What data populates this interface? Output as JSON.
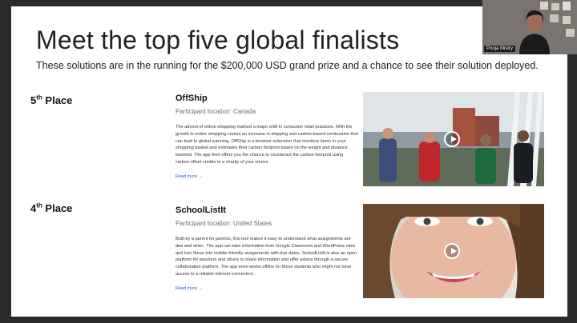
{
  "slide": {
    "title": "Meet the top five global finalists",
    "subtitle": "These solutions are in the running for the $200,000 USD grand prize and a chance to see their solution deployed."
  },
  "entries": [
    {
      "place_number": "5",
      "place_suffix": "th",
      "place_word": " Place",
      "name": "OffShip",
      "location": "Participant location: Canada",
      "description": "The advent of online shopping marked a major shift in consumer retail practices. With the growth in online shopping comes an increase in shipping and carbon-based combustion that can lead to global warming. OffShip is a browser extension that monitors items in your shopping basket and estimates their carbon footprint based on the weight and distance traveled. The app then offers you the chance to counteract the carbon footprint using carbon offset credits to a charity of your choice",
      "read_more": "Read more →"
    },
    {
      "place_number": "4",
      "place_suffix": "th",
      "place_word": " Place",
      "name": "SchoolListIt",
      "location": "Participant location: United States",
      "description": "Built by a parent for parents, this tool makes it easy to understand what assignments are due and when. The app can take information from Google Classroom and WordPress sites and turn these into mobile-friendly assignments with due dates. SchoolListIt is also an open platform for teachers and others to share information and offer advice through a secure collaboration platform. The app even works offline for those students who might not have access to a reliable internet connection.",
      "read_more": "Read more →"
    }
  ],
  "video_call": {
    "participant_name": "Pooja Mistry"
  },
  "icons": {
    "play": "play-button-icon"
  }
}
